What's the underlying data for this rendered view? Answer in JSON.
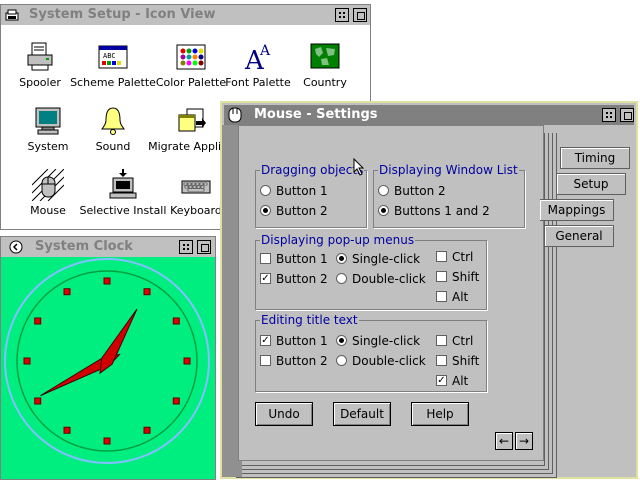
{
  "setup_window": {
    "title": "System Setup - Icon View",
    "icons": [
      {
        "label": "Spooler",
        "icon": "printer-icon"
      },
      {
        "label": "Scheme Palette",
        "icon": "scheme-palette-icon"
      },
      {
        "label": "Color Palette",
        "icon": "color-palette-icon"
      },
      {
        "label": "Font Palette",
        "icon": "font-palette-icon"
      },
      {
        "label": "Country",
        "icon": "globe-map-icon"
      },
      {
        "label": "System",
        "icon": "monitor-icon"
      },
      {
        "label": "Sound",
        "icon": "bell-icon"
      },
      {
        "label": "Migrate Applica",
        "icon": "migrate-icon"
      },
      {
        "label": "Mouse",
        "icon": "mouse-icon"
      },
      {
        "label": "Selective Install",
        "icon": "computer-install-icon"
      },
      {
        "label": "Keyboard",
        "icon": "keyboard-icon"
      }
    ]
  },
  "clock_window": {
    "title": "System Clock",
    "background": "#00ee80",
    "hour": 8,
    "minute": 5
  },
  "mouse_window": {
    "title": "Mouse - Settings",
    "groups": {
      "dragging": {
        "title": "Dragging objects",
        "options": [
          {
            "label": "Button 1",
            "selected": false
          },
          {
            "label": "Button 2",
            "selected": true
          }
        ]
      },
      "window_list": {
        "title": "Displaying Window List",
        "options": [
          {
            "label": "Button 2",
            "selected": false
          },
          {
            "label": "Buttons 1 and 2",
            "selected": true
          }
        ]
      },
      "popup": {
        "title": "Displaying pop-up menus",
        "buttons": [
          {
            "label": "Button 1",
            "checked": false
          },
          {
            "label": "Button 2",
            "checked": true
          }
        ],
        "clicks": [
          {
            "label": "Single-click",
            "selected": true
          },
          {
            "label": "Double-click",
            "selected": false
          }
        ],
        "keys": [
          {
            "label": "Ctrl",
            "checked": false
          },
          {
            "label": "Shift",
            "checked": false
          },
          {
            "label": "Alt",
            "checked": false
          }
        ]
      },
      "title_text": {
        "title": "Editing title text",
        "buttons": [
          {
            "label": "Button 1",
            "checked": true
          },
          {
            "label": "Button 2",
            "checked": false
          }
        ],
        "clicks": [
          {
            "label": "Single-click",
            "selected": true
          },
          {
            "label": "Double-click",
            "selected": false
          }
        ],
        "keys": [
          {
            "label": "Ctrl",
            "checked": false
          },
          {
            "label": "Shift",
            "checked": false
          },
          {
            "label": "Alt",
            "checked": true
          }
        ]
      }
    },
    "buttons": {
      "undo": "Undo",
      "default": "Default",
      "help": "Help"
    },
    "tabs": [
      {
        "label": "Timing",
        "active": false
      },
      {
        "label": "Setup",
        "active": false
      },
      {
        "label": "Mappings",
        "active": true
      },
      {
        "label": "General",
        "active": false
      }
    ],
    "nav": {
      "prev": "←",
      "next": "→"
    }
  }
}
